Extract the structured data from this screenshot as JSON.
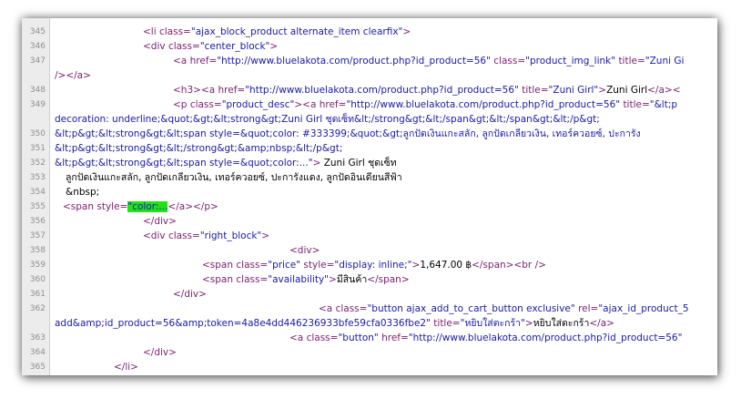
{
  "source_view": {
    "lines": [
      {
        "num": "345",
        "indent": 133,
        "segs": [
          {
            "c": "tag",
            "t": "<li "
          },
          {
            "c": "attr",
            "t": "class="
          },
          {
            "c": "val",
            "t": "\"ajax_block_product  alternate_item clearfix\""
          },
          {
            "c": "tag",
            "t": ">"
          }
        ]
      },
      {
        "num": "346",
        "indent": 133,
        "segs": [
          {
            "c": "tag",
            "t": "<div "
          },
          {
            "c": "attr",
            "t": "class="
          },
          {
            "c": "val",
            "t": "\"center_block\""
          },
          {
            "c": "tag",
            "t": ">"
          }
        ]
      },
      {
        "num": "347",
        "indent": 166,
        "segs": [
          {
            "c": "tag",
            "t": "<a "
          },
          {
            "c": "attr",
            "t": "href="
          },
          {
            "c": "val",
            "t": "\"http://www.bluelakota.com/product.php?id_product=56\""
          },
          {
            "c": "txt",
            "t": " "
          },
          {
            "c": "attr",
            "t": "class="
          },
          {
            "c": "val",
            "t": "\"product_img_link\""
          },
          {
            "c": "txt",
            "t": " "
          },
          {
            "c": "attr",
            "t": "title="
          },
          {
            "c": "val",
            "t": "\"Zuni Gi"
          }
        ]
      },
      {
        "num": "",
        "indent": 36,
        "segs": [
          {
            "c": "tag",
            "t": "/></a>"
          }
        ]
      },
      {
        "num": "348",
        "indent": 166,
        "segs": [
          {
            "c": "tag",
            "t": "<h3><a "
          },
          {
            "c": "attr",
            "t": "href="
          },
          {
            "c": "val",
            "t": "\"http://www.bluelakota.com/product.php?id_product=56\""
          },
          {
            "c": "txt",
            "t": " "
          },
          {
            "c": "attr",
            "t": "title="
          },
          {
            "c": "val",
            "t": "\"Zuni Girl\""
          },
          {
            "c": "tag",
            "t": ">"
          },
          {
            "c": "txt",
            "t": "Zuni Girl"
          },
          {
            "c": "tag",
            "t": "</a><"
          }
        ]
      },
      {
        "num": "349",
        "indent": 166,
        "segs": [
          {
            "c": "tag",
            "t": "<p "
          },
          {
            "c": "attr",
            "t": "class="
          },
          {
            "c": "val",
            "t": "\"product_desc\""
          },
          {
            "c": "tag",
            "t": "><a "
          },
          {
            "c": "attr",
            "t": "href="
          },
          {
            "c": "val",
            "t": "\"http://www.bluelakota.com/product.php?id_product=56\""
          },
          {
            "c": "txt",
            "t": " "
          },
          {
            "c": "attr",
            "t": "title="
          },
          {
            "c": "val",
            "t": "\"&lt;p"
          }
        ]
      },
      {
        "num": "",
        "indent": 36,
        "segs": [
          {
            "c": "val",
            "t": "decoration: underline;&quot;&gt;&lt;strong&gt;Zuni Girl ชุดเซ็ท&lt;/strong&gt;&lt;/span&gt;&lt;/span&gt;&lt;/p&gt;"
          }
        ]
      },
      {
        "num": "350",
        "indent": 36,
        "segs": [
          {
            "c": "val",
            "t": "&lt;p&gt;&lt;strong&gt;&lt;span style=&quot;color: #333399;&quot;&gt;ลูกปัดเงินแกะสลัก, ลูกปัดเกลียวเงิน, เทอร์ควอยซ์, ปะการัง"
          }
        ]
      },
      {
        "num": "351",
        "indent": 36,
        "segs": [
          {
            "c": "val",
            "t": "&lt;p&gt;&lt;strong&gt;&lt;/strong&gt;&amp;nbsp;&lt;/p&gt;"
          }
        ]
      },
      {
        "num": "352",
        "indent": 36,
        "segs": [
          {
            "c": "val",
            "t": "&lt;p&gt;&lt;strong&gt;&lt;span style=&quot;color:...\""
          },
          {
            "c": "tag",
            "t": ">"
          },
          {
            "c": "txt",
            "t": "    Zuni Girl ชุดเซ็ท"
          }
        ]
      },
      {
        "num": "353",
        "indent": 48,
        "segs": [
          {
            "c": "txt",
            "t": "ลูกปัดเงินแกะสลัก, ลูกปัดเกลียวเงิน, เทอร์ควอยซ์, ปะการังแดง, ลูกปัดอินเดียนสีฟ้า"
          }
        ]
      },
      {
        "num": "354",
        "indent": 48,
        "segs": [
          {
            "c": "txt",
            "t": "&nbsp;"
          }
        ]
      },
      {
        "num": "355",
        "indent": 45,
        "segs": [
          {
            "c": "tag",
            "t": "<span "
          },
          {
            "c": "attr",
            "t": "style="
          },
          {
            "c": "val hl",
            "t": "\"color:..."
          },
          {
            "c": "tag",
            "t": "</a></p>"
          }
        ]
      },
      {
        "num": "356",
        "indent": 133,
        "segs": [
          {
            "c": "tag",
            "t": "</div>"
          }
        ]
      },
      {
        "num": "357",
        "indent": 133,
        "segs": [
          {
            "c": "tag",
            "t": "<div "
          },
          {
            "c": "attr",
            "t": "class="
          },
          {
            "c": "val",
            "t": "\"right_block\""
          },
          {
            "c": "tag",
            "t": ">"
          }
        ]
      },
      {
        "num": "358",
        "indent": 294,
        "segs": [
          {
            "c": "tag",
            "t": "<div>"
          }
        ]
      },
      {
        "num": "359",
        "indent": 198,
        "segs": [
          {
            "c": "tag",
            "t": "<span "
          },
          {
            "c": "attr",
            "t": "class="
          },
          {
            "c": "val",
            "t": "\"price\""
          },
          {
            "c": "txt",
            "t": " "
          },
          {
            "c": "attr",
            "t": "style="
          },
          {
            "c": "val",
            "t": "\"display: inline;\""
          },
          {
            "c": "tag",
            "t": ">"
          },
          {
            "c": "txt",
            "t": "1,647.00 ฿"
          },
          {
            "c": "tag",
            "t": "</span><br />"
          }
        ]
      },
      {
        "num": "360",
        "indent": 198,
        "segs": [
          {
            "c": "tag",
            "t": "<span "
          },
          {
            "c": "attr",
            "t": "class="
          },
          {
            "c": "val",
            "t": "\"availability\""
          },
          {
            "c": "tag",
            "t": ">"
          },
          {
            "c": "txt",
            "t": "มีสินค้า"
          },
          {
            "c": "tag",
            "t": "</span>"
          }
        ]
      },
      {
        "num": "361",
        "indent": 166,
        "segs": [
          {
            "c": "tag",
            "t": "</div>"
          }
        ]
      },
      {
        "num": "362",
        "indent": 326,
        "segs": [
          {
            "c": "tag",
            "t": "<a "
          },
          {
            "c": "attr",
            "t": "class="
          },
          {
            "c": "val",
            "t": "\"button ajax_add_to_cart_button exclusive\""
          },
          {
            "c": "txt",
            "t": " "
          },
          {
            "c": "attr",
            "t": "rel="
          },
          {
            "c": "val",
            "t": "\"ajax_id_product_5"
          }
        ]
      },
      {
        "num": "",
        "indent": 36,
        "segs": [
          {
            "c": "val",
            "t": "add&amp;id_product=56&amp;token=4a8e4dd446236933bfe59cfa0336fbe2\""
          },
          {
            "c": "txt",
            "t": " "
          },
          {
            "c": "attr",
            "t": "title="
          },
          {
            "c": "val",
            "t": "\"หยิบใส่ตะกร้า\""
          },
          {
            "c": "tag",
            "t": ">"
          },
          {
            "c": "txt",
            "t": "หยิบใส่ตะกร้า"
          },
          {
            "c": "tag",
            "t": "</a>"
          }
        ]
      },
      {
        "num": "363",
        "indent": 294,
        "segs": [
          {
            "c": "tag",
            "t": "<a "
          },
          {
            "c": "attr",
            "t": "class="
          },
          {
            "c": "val",
            "t": "\"button\""
          },
          {
            "c": "txt",
            "t": " "
          },
          {
            "c": "attr",
            "t": "href="
          },
          {
            "c": "val",
            "t": "\"http://www.bluelakota.com/product.php?id_product=56\""
          }
        ]
      },
      {
        "num": "364",
        "indent": 133,
        "segs": [
          {
            "c": "tag",
            "t": "</div>"
          }
        ]
      },
      {
        "num": "365",
        "indent": 101,
        "segs": [
          {
            "c": "tag",
            "t": "</li>"
          }
        ]
      }
    ]
  }
}
